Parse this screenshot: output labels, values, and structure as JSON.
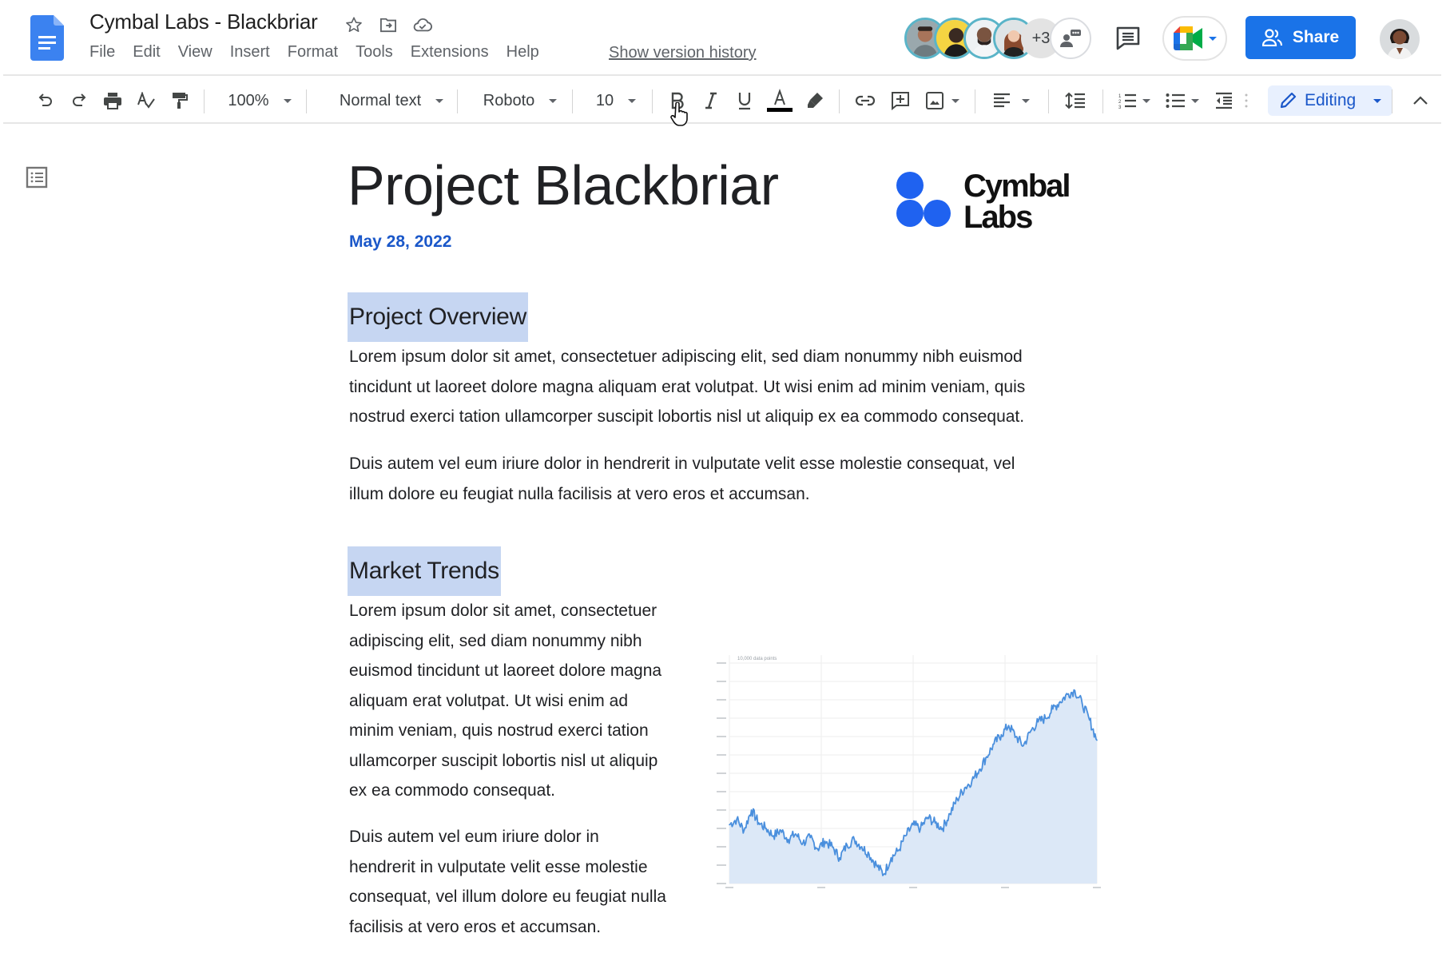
{
  "app": {
    "doc_title": "Cymbal Labs - Blackbriar",
    "menu": [
      "File",
      "Edit",
      "View",
      "Insert",
      "Format",
      "Tools",
      "Extensions",
      "Help"
    ],
    "version_history_link": "Show version history",
    "collaborators_more": "+3",
    "share_label": "Share",
    "colors": {
      "accent": "#1a73e8",
      "heading_highlight": "#c6d6f2",
      "date_blue": "#1a57c9",
      "editing_bg": "#e8f0fe",
      "chart_line": "#4a8fdd",
      "chart_fill": "#dce8f7"
    }
  },
  "toolbar": {
    "icons": [
      "undo-icon",
      "redo-icon",
      "print-icon",
      "spellcheck-icon",
      "paint-format-icon"
    ],
    "zoom": "100%",
    "style": "Normal text",
    "font": "Roboto",
    "font_size": "10",
    "format_icons": [
      "bold-icon",
      "italic-icon",
      "underline-icon",
      "text-color-icon",
      "highlight-icon"
    ],
    "insert_icons": [
      "link-icon",
      "add-comment-icon",
      "image-icon"
    ],
    "mode": "Editing"
  },
  "document": {
    "title": "Project Blackbriar",
    "date": "May 28, 2022",
    "logo_text": [
      "Cymbal",
      "Labs"
    ],
    "sections": [
      {
        "heading": "Project Overview",
        "paragraphs": [
          [
            "Lorem ipsum dolor sit amet, consectetuer adipiscing elit, sed diam nonummy nibh euismod",
            "tincidunt ut laoreet dolore magna aliquam erat volutpat. Ut wisi enim ad minim veniam, quis",
            "nostrud exerci tation ullamcorper suscipit lobortis nisl ut aliquip ex ea commodo consequat."
          ],
          [
            "Duis autem vel eum iriure dolor in hendrerit in vulputate velit esse molestie consequat, vel",
            "illum dolore eu feugiat nulla facilisis at vero eros et accumsan."
          ]
        ]
      },
      {
        "heading": "Market Trends",
        "paragraphs": [
          [
            "Lorem ipsum dolor sit amet, consectetuer",
            "adipiscing elit, sed diam nonummy nibh",
            "euismod tincidunt ut laoreet dolore magna",
            "aliquam erat volutpat. Ut wisi enim ad",
            "minim veniam, quis nostrud exerci tation",
            "ullamcorper suscipit lobortis nisl ut aliquip",
            "ex ea commodo consequat."
          ],
          [
            "Duis autem vel eum iriure dolor in",
            "hendrerit in vulputate velit esse molestie",
            "consequat, vel illum dolore eu feugiat nulla",
            "facilisis at vero eros et accumsan."
          ]
        ]
      }
    ]
  },
  "chart_data": {
    "type": "area",
    "title": "10,000 data points",
    "xlabel": "",
    "ylabel": "",
    "grid": true,
    "legend": "none",
    "xlim": [
      0,
      10000
    ],
    "ylim": [
      0,
      12
    ],
    "y_gridlines": 12,
    "x_gridlines": 4,
    "series": [
      {
        "name": "value",
        "x": [
          0,
          200,
          400,
          600,
          800,
          1000,
          1200,
          1400,
          1600,
          1800,
          2000,
          2200,
          2400,
          2600,
          2800,
          3000,
          3200,
          3400,
          3600,
          3800,
          4000,
          4200,
          4400,
          4600,
          4800,
          5000,
          5200,
          5400,
          5600,
          5800,
          6000,
          6200,
          6400,
          6600,
          6800,
          7000,
          7200,
          7400,
          7600,
          7800,
          8000,
          8200,
          8400,
          8600,
          8800,
          9000,
          9200,
          9400,
          9600,
          9800,
          10000
        ],
        "values": [
          3.2,
          3.5,
          2.9,
          4.0,
          3.3,
          3.0,
          2.6,
          2.9,
          2.4,
          2.7,
          2.2,
          2.5,
          1.9,
          2.3,
          2.0,
          1.4,
          2.1,
          2.4,
          2.0,
          1.6,
          1.0,
          0.5,
          1.4,
          1.8,
          2.6,
          3.2,
          3.0,
          3.6,
          3.3,
          3.0,
          3.8,
          4.6,
          5.2,
          5.6,
          6.2,
          6.9,
          7.6,
          8.1,
          8.6,
          8.0,
          7.5,
          8.3,
          8.8,
          9.0,
          9.5,
          9.9,
          10.3,
          10.5,
          9.8,
          8.9,
          7.8
        ]
      }
    ]
  }
}
